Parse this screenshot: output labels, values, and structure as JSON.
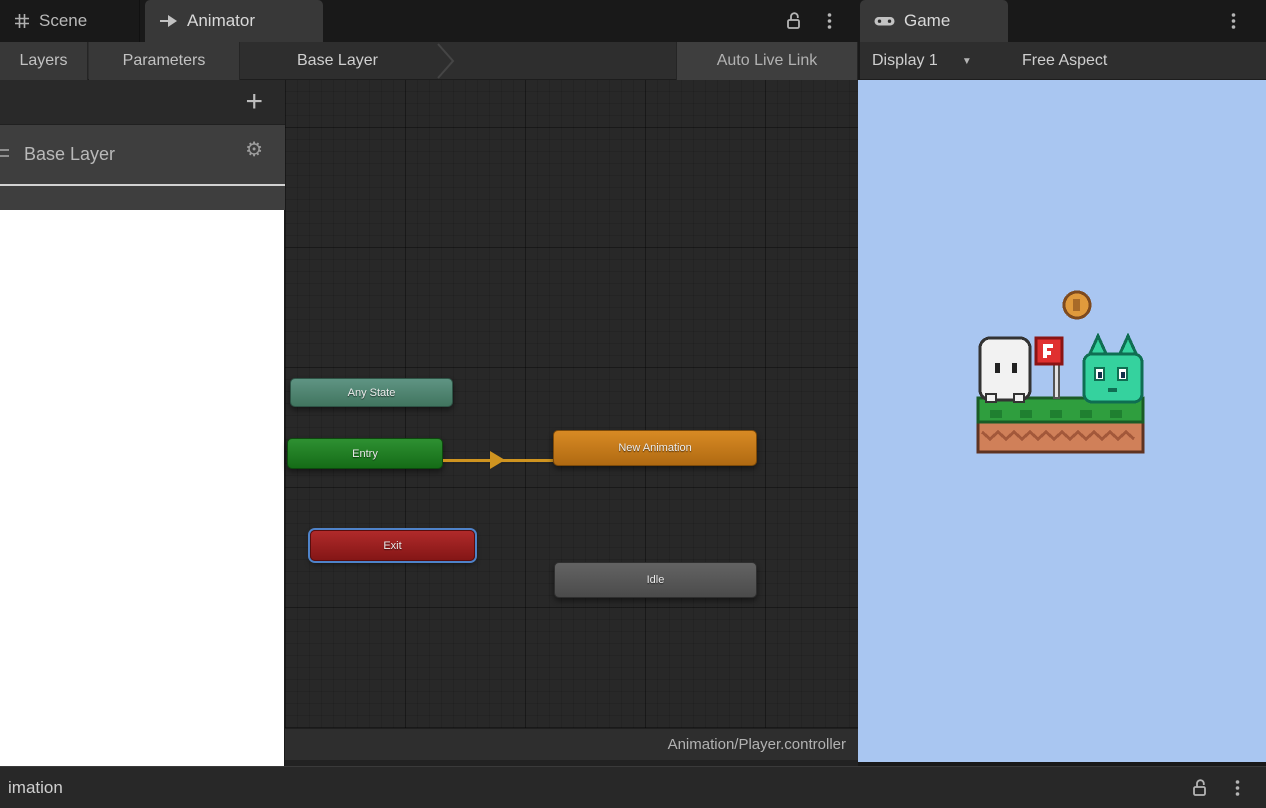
{
  "window": {
    "tabs_left": [
      {
        "label": "Scene",
        "active": false
      },
      {
        "label": "Animator",
        "active": true
      }
    ],
    "tabs_right": [
      {
        "label": "Game",
        "active": true
      }
    ]
  },
  "animator": {
    "toolbar": {
      "layers_label": "Layers",
      "parameters_label": "Parameters",
      "breadcrumb": "Base Layer",
      "auto_live_link_label": "Auto Live Link"
    },
    "layers_panel": {
      "layer_name": "Base Layer"
    },
    "graph": {
      "nodes": [
        {
          "id": "any-state",
          "label": "Any State",
          "color": "#4e8a75",
          "selected": false
        },
        {
          "id": "entry",
          "label": "Entry",
          "color": "#1e7d1e",
          "selected": false
        },
        {
          "id": "new-animation",
          "label": "New Animation",
          "color": "#c87a1c",
          "selected": false
        },
        {
          "id": "exit",
          "label": "Exit",
          "color": "#9c1d1d",
          "selected": true
        },
        {
          "id": "idle",
          "label": "Idle",
          "color": "#555555",
          "selected": false
        }
      ],
      "transitions": [
        {
          "from": "entry",
          "to": "new-animation",
          "color": "#cf9420"
        }
      ],
      "asset_path": "Animation/Player.controller"
    }
  },
  "game": {
    "toolbar": {
      "display_label": "Display 1",
      "aspect_label": "Free Aspect"
    },
    "viewport": {
      "background_color": "#a9c6f1",
      "entities": [
        "coin",
        "player-character",
        "goal-flag",
        "green-creature",
        "grass-platform"
      ]
    }
  },
  "status_bar": {
    "clipped_tab_label": "imation"
  }
}
